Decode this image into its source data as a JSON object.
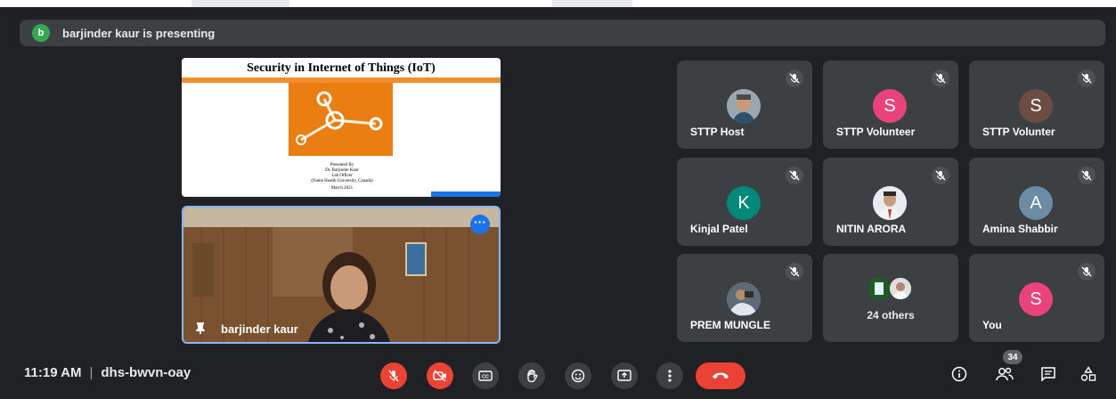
{
  "banner": {
    "avatar_letter": "b",
    "text": "barjinder kaur is presenting",
    "avatar_color": "#34a853"
  },
  "slide": {
    "title": "Security in Internet of Things (IoT)",
    "presented_lines": [
      "Presented By",
      "Dr. Barjinder Kaur",
      "Lab Officer",
      "(Name Health University, Canada)",
      "March 2021"
    ]
  },
  "presenter": {
    "name": "barjinder kaur"
  },
  "participants": [
    {
      "name": "STTP Host",
      "avatar": "photo"
    },
    {
      "name": "STTP Volunteer",
      "avatar": "S",
      "color": "#e8437a"
    },
    {
      "name": "STTP Volunter",
      "avatar": "S",
      "color": "#6d4c41"
    },
    {
      "name": "Kinjal Patel",
      "avatar": "K",
      "color": "#00897b"
    },
    {
      "name": "NITIN ARORA",
      "avatar": "photo"
    },
    {
      "name": "Amina Shabbir",
      "avatar": "A",
      "color": "#6c8ca5"
    },
    {
      "name": "PREM MUNGLE",
      "avatar": "photo"
    },
    {
      "name": "24 others",
      "avatar": "group"
    },
    {
      "name": "You",
      "avatar": "S",
      "color": "#e8437a"
    }
  ],
  "meeting": {
    "time": "11:19 AM",
    "code": "dhs-bwvn-oay"
  },
  "people_count": "34",
  "colors": {
    "accent": "#1a73e8",
    "danger": "#ea4335",
    "tile": "#3c4043",
    "bg": "#202124"
  }
}
